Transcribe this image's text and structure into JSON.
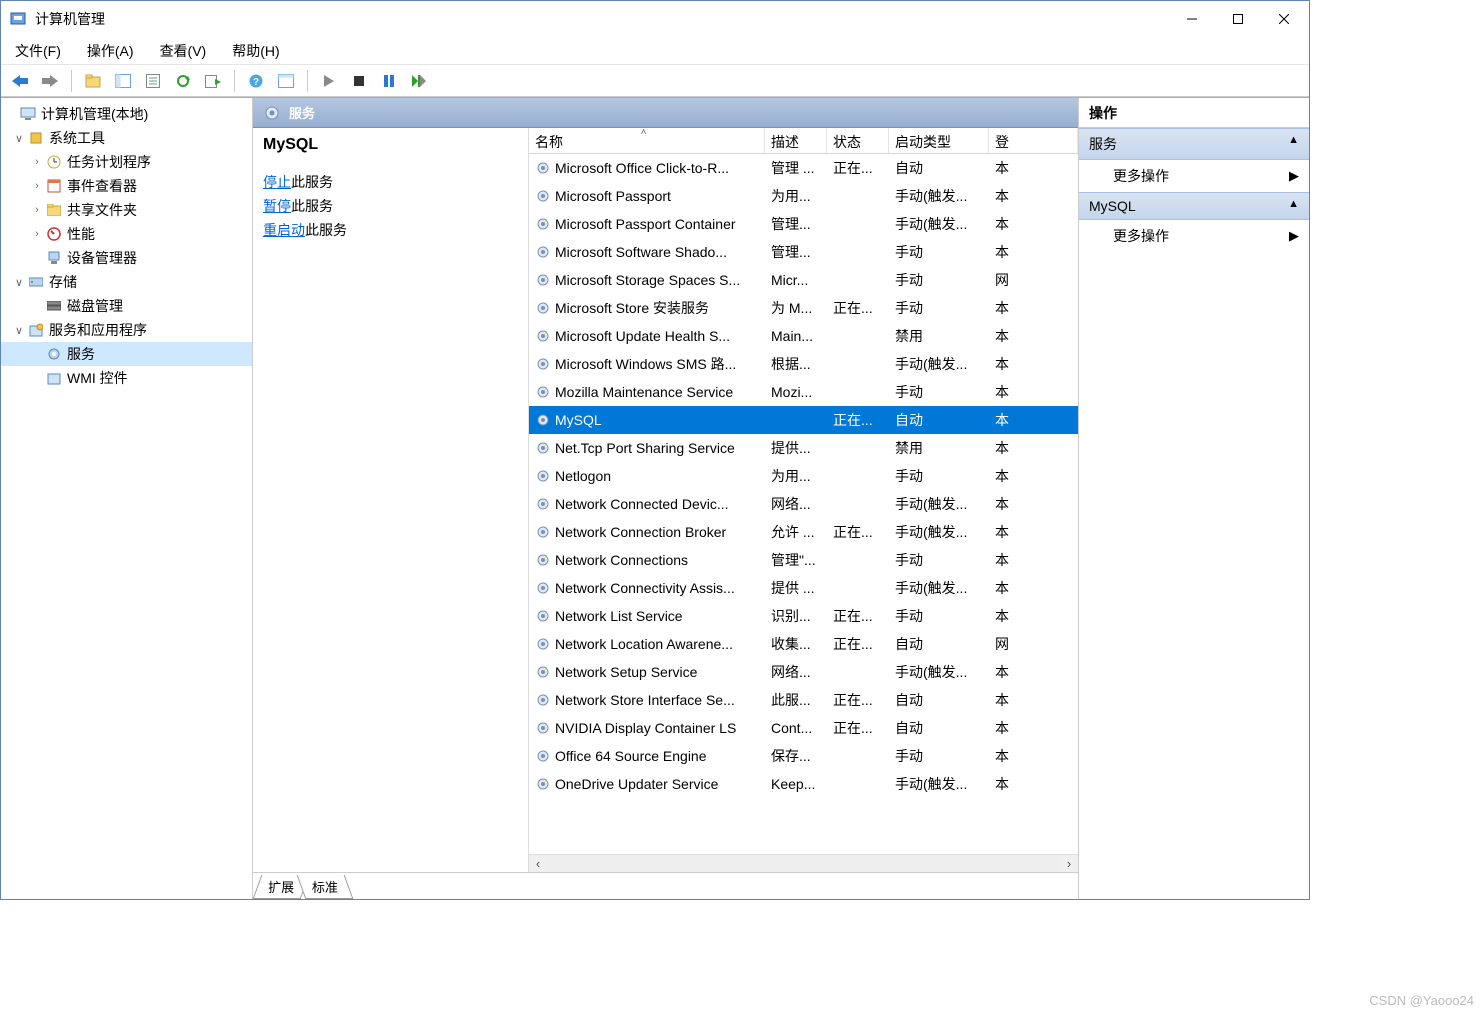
{
  "window": {
    "title": "计算机管理"
  },
  "menu": {
    "file": "文件(F)",
    "action": "操作(A)",
    "view": "查看(V)",
    "help": "帮助(H)"
  },
  "nav": {
    "root": "计算机管理(本地)",
    "sys_tools": "系统工具",
    "task_sched": "任务计划程序",
    "event_viewer": "事件查看器",
    "shared_folders": "共享文件夹",
    "performance": "性能",
    "device_mgr": "设备管理器",
    "storage": "存储",
    "disk_mgmt": "磁盘管理",
    "svc_apps": "服务和应用程序",
    "services": "服务",
    "wmi": "WMI 控件"
  },
  "panel": {
    "title": "服务"
  },
  "detail": {
    "selected_name": "MySQL",
    "stop_link": "停止",
    "stop_suffix": "此服务",
    "pause_link": "暂停",
    "pause_suffix": "此服务",
    "restart_link": "重启动",
    "restart_suffix": "此服务"
  },
  "columns": {
    "name": "名称",
    "desc": "描述",
    "status": "状态",
    "startup": "启动类型",
    "logon": "登"
  },
  "col_widths": {
    "name": 236,
    "desc": 62,
    "status": 62,
    "startup": 100,
    "logon": 28
  },
  "services": [
    {
      "name": "Microsoft Office Click-to-R...",
      "desc": "管理 ...",
      "status": "正在...",
      "startup": "自动",
      "logon": "本"
    },
    {
      "name": "Microsoft Passport",
      "desc": "为用...",
      "status": "",
      "startup": "手动(触发...",
      "logon": "本"
    },
    {
      "name": "Microsoft Passport Container",
      "desc": "管理...",
      "status": "",
      "startup": "手动(触发...",
      "logon": "本"
    },
    {
      "name": "Microsoft Software Shado...",
      "desc": "管理...",
      "status": "",
      "startup": "手动",
      "logon": "本"
    },
    {
      "name": "Microsoft Storage Spaces S...",
      "desc": "Micr...",
      "status": "",
      "startup": "手动",
      "logon": "网"
    },
    {
      "name": "Microsoft Store 安装服务",
      "desc": "为 M...",
      "status": "正在...",
      "startup": "手动",
      "logon": "本"
    },
    {
      "name": "Microsoft Update Health S...",
      "desc": "Main...",
      "status": "",
      "startup": "禁用",
      "logon": "本"
    },
    {
      "name": "Microsoft Windows SMS 路...",
      "desc": "根据...",
      "status": "",
      "startup": "手动(触发...",
      "logon": "本"
    },
    {
      "name": "Mozilla Maintenance Service",
      "desc": "Mozi...",
      "status": "",
      "startup": "手动",
      "logon": "本"
    },
    {
      "name": "MySQL",
      "desc": "",
      "status": "正在...",
      "startup": "自动",
      "logon": "本",
      "selected": true
    },
    {
      "name": "Net.Tcp Port Sharing Service",
      "desc": "提供...",
      "status": "",
      "startup": "禁用",
      "logon": "本"
    },
    {
      "name": "Netlogon",
      "desc": "为用...",
      "status": "",
      "startup": "手动",
      "logon": "本"
    },
    {
      "name": "Network Connected Devic...",
      "desc": "网络...",
      "status": "",
      "startup": "手动(触发...",
      "logon": "本"
    },
    {
      "name": "Network Connection Broker",
      "desc": "允许 ...",
      "status": "正在...",
      "startup": "手动(触发...",
      "logon": "本"
    },
    {
      "name": "Network Connections",
      "desc": "管理\"...",
      "status": "",
      "startup": "手动",
      "logon": "本"
    },
    {
      "name": "Network Connectivity Assis...",
      "desc": "提供 ...",
      "status": "",
      "startup": "手动(触发...",
      "logon": "本"
    },
    {
      "name": "Network List Service",
      "desc": "识别...",
      "status": "正在...",
      "startup": "手动",
      "logon": "本"
    },
    {
      "name": "Network Location Awarene...",
      "desc": "收集...",
      "status": "正在...",
      "startup": "自动",
      "logon": "网"
    },
    {
      "name": "Network Setup Service",
      "desc": "网络...",
      "status": "",
      "startup": "手动(触发...",
      "logon": "本"
    },
    {
      "name": "Network Store Interface Se...",
      "desc": "此服...",
      "status": "正在...",
      "startup": "自动",
      "logon": "本"
    },
    {
      "name": "NVIDIA Display Container LS",
      "desc": "Cont...",
      "status": "正在...",
      "startup": "自动",
      "logon": "本"
    },
    {
      "name": "Office 64 Source Engine",
      "desc": "保存...",
      "status": "",
      "startup": "手动",
      "logon": "本"
    },
    {
      "name": "OneDrive Updater Service",
      "desc": "Keep...",
      "status": "",
      "startup": "手动(触发...",
      "logon": "本"
    }
  ],
  "tabs": {
    "extended": "扩展",
    "standard": "标准"
  },
  "actions": {
    "title": "操作",
    "sec1": "服务",
    "more1": "更多操作",
    "sec2": "MySQL",
    "more2": "更多操作"
  },
  "watermark": "CSDN @Yaooo24"
}
